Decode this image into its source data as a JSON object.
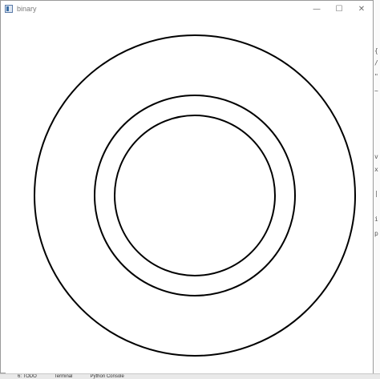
{
  "window": {
    "title": "binary",
    "icon": "app-window-icon",
    "controls": {
      "minimize": "—",
      "maximize": "☐",
      "close": "✕"
    }
  },
  "canvas": {
    "background": "#ffffff",
    "stroke_color": "#000000",
    "rings": [
      {
        "name": "outer-circle"
      },
      {
        "name": "middle-circle"
      },
      {
        "name": "inner-circle"
      }
    ]
  },
  "side_text": [
    "{",
    "/",
    "\"",
    "~",
    "v",
    "x",
    "|",
    "i",
    "p"
  ],
  "taskbar": {
    "items": [
      "6: TODO",
      "Terminal",
      "Python Console"
    ]
  }
}
